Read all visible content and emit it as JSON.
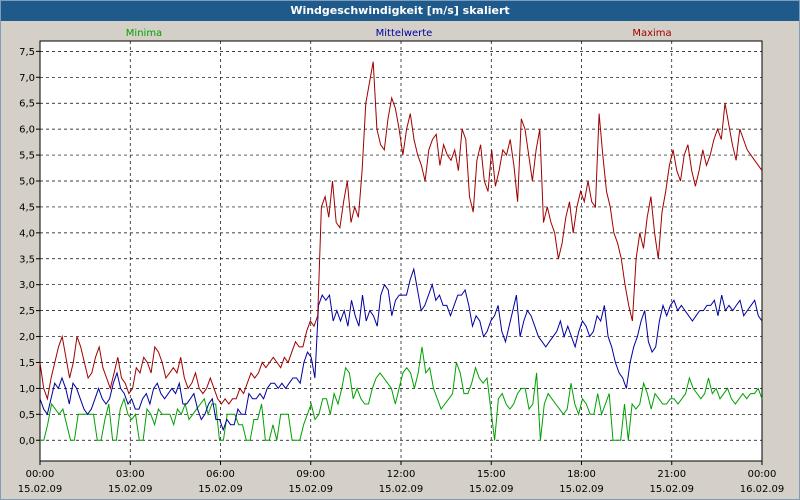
{
  "window": {
    "title": "Windgeschwindigkeit [m/s] skaliert"
  },
  "chart_data": {
    "type": "line",
    "title": "Windgeschwindigkeit [m/s] skaliert",
    "xlabel": "",
    "ylabel": "",
    "ylim": [
      -0.4,
      7.7
    ],
    "xlim": [
      0,
      24
    ],
    "yticks": [
      "0,0",
      "0,5",
      "1,0",
      "1,5",
      "2,0",
      "2,5",
      "3,0",
      "3,5",
      "4,0",
      "4,5",
      "5,0",
      "5,5",
      "6,0",
      "6,5",
      "7,0",
      "7,5"
    ],
    "ytick_values": [
      0,
      0.5,
      1,
      1.5,
      2,
      2.5,
      3,
      3.5,
      4,
      4.5,
      5,
      5.5,
      6,
      6.5,
      7,
      7.5
    ],
    "xticks": [
      {
        "x": 0,
        "time": "00:00",
        "date": "15.02.09"
      },
      {
        "x": 3,
        "time": "03:00",
        "date": "15.02.09"
      },
      {
        "x": 6,
        "time": "06:00",
        "date": "15.02.09"
      },
      {
        "x": 9,
        "time": "09:00",
        "date": "15.02.09"
      },
      {
        "x": 12,
        "time": "12:00",
        "date": "15.02.09"
      },
      {
        "x": 15,
        "time": "15:00",
        "date": "15.02.09"
      },
      {
        "x": 18,
        "time": "18:00",
        "date": "15.02.09"
      },
      {
        "x": 21,
        "time": "21:00",
        "date": "15.02.09"
      },
      {
        "x": 24,
        "time": "00:00",
        "date": "16.02.09"
      }
    ],
    "grid": true,
    "legend_position": "top",
    "series": [
      {
        "name": "Minima",
        "color": "#00a000",
        "values": [
          0.0,
          0.0,
          0.3,
          0.7,
          0.6,
          0.5,
          0.6,
          0.3,
          0.0,
          0.0,
          0.5,
          0.5,
          0.5,
          0.5,
          0.5,
          0.0,
          0.0,
          0.4,
          0.7,
          0.0,
          0.0,
          0.6,
          0.8,
          0.5,
          0.4,
          0.5,
          0.0,
          0.0,
          0.6,
          0.5,
          0.3,
          0.6,
          0.5,
          0.5,
          0.5,
          0.3,
          0.6,
          0.5,
          0.7,
          0.4,
          0.5,
          0.6,
          0.7,
          0.8,
          0.5,
          0.7,
          0.7,
          0.0,
          0.0,
          0.5,
          0.5,
          0.5,
          0.3,
          0.3,
          0.0,
          0.0,
          0.4,
          0.4,
          0.7,
          0.0,
          0.0,
          0.3,
          0.0,
          0.5,
          0.5,
          0.5,
          0.0,
          0.0,
          0.0,
          0.3,
          0.5,
          0.7,
          0.4,
          0.5,
          0.8,
          0.8,
          0.5,
          0.9,
          0.7,
          1.0,
          1.4,
          1.3,
          0.8,
          1.0,
          0.8,
          0.7,
          0.7,
          1.0,
          1.2,
          1.3,
          1.2,
          1.1,
          1.0,
          0.7,
          1.0,
          1.3,
          1.4,
          1.3,
          1.0,
          1.3,
          1.8,
          1.3,
          1.4,
          1.0,
          0.8,
          0.6,
          0.7,
          0.8,
          0.9,
          1.5,
          1.3,
          0.9,
          0.9,
          1.1,
          1.4,
          1.2,
          1.1,
          1.2,
          0.6,
          0.0,
          0.8,
          0.9,
          0.7,
          0.6,
          0.7,
          0.9,
          1.0,
          1.0,
          0.6,
          0.7,
          1.3,
          0.0,
          0.7,
          0.9,
          0.8,
          0.7,
          0.6,
          0.5,
          0.6,
          1.1,
          0.7,
          0.5,
          0.8,
          0.7,
          0.5,
          0.5,
          0.9,
          0.5,
          0.7,
          0.9,
          0.0,
          0.0,
          0.0,
          0.7,
          0.0,
          0.7,
          0.6,
          0.7,
          1.1,
          0.9,
          0.6,
          0.9,
          0.8,
          0.7,
          0.7,
          0.8,
          0.8,
          0.7,
          0.8,
          0.9,
          1.2,
          1.0,
          0.9,
          0.8,
          0.9,
          1.2,
          0.9,
          1.0,
          0.8,
          0.9,
          1.0,
          0.8,
          0.7,
          0.8,
          0.9,
          0.8,
          0.9,
          0.9,
          1.0,
          0.8
        ]
      },
      {
        "name": "Mittelwerte",
        "color": "#0000a0",
        "values": [
          0.8,
          0.6,
          0.5,
          0.8,
          1.1,
          1.0,
          1.2,
          1.0,
          0.7,
          1.1,
          1.0,
          0.8,
          0.6,
          0.5,
          0.6,
          0.8,
          1.0,
          0.8,
          0.7,
          0.8,
          1.1,
          1.3,
          1.0,
          0.9,
          0.7,
          0.8,
          0.6,
          0.6,
          0.8,
          0.9,
          0.7,
          1.0,
          1.1,
          0.9,
          0.8,
          0.9,
          1.0,
          0.9,
          1.1,
          0.7,
          0.7,
          0.8,
          0.9,
          0.6,
          0.4,
          0.5,
          0.7,
          0.8,
          0.4,
          0.4,
          0.2,
          0.4,
          0.3,
          0.3,
          0.6,
          0.5,
          0.5,
          0.9,
          0.8,
          0.8,
          0.9,
          0.8,
          1.0,
          1.1,
          1.1,
          1.0,
          1.1,
          1.0,
          1.1,
          1.2,
          1.2,
          1.1,
          1.5,
          1.7,
          1.6,
          1.2,
          2.6,
          2.8,
          2.7,
          2.8,
          2.3,
          2.5,
          2.3,
          2.5,
          2.2,
          2.7,
          2.4,
          2.2,
          2.8,
          2.3,
          2.5,
          2.4,
          2.2,
          2.8,
          3.0,
          2.9,
          2.4,
          2.7,
          2.8,
          2.8,
          2.8,
          3.1,
          3.3,
          2.9,
          2.5,
          2.6,
          2.8,
          3.0,
          2.7,
          2.8,
          2.6,
          2.6,
          2.4,
          2.6,
          2.8,
          2.8,
          2.9,
          2.6,
          2.2,
          2.4,
          2.3,
          2.0,
          2.1,
          2.3,
          2.4,
          2.6,
          2.1,
          1.9,
          2.2,
          2.5,
          2.8,
          2.0,
          2.3,
          2.5,
          2.4,
          2.2,
          2.0,
          1.9,
          1.8,
          1.9,
          2.0,
          2.1,
          2.3,
          2.0,
          2.2,
          2.0,
          1.8,
          2.1,
          2.3,
          2.2,
          2.0,
          2.1,
          2.4,
          2.3,
          2.6,
          2.0,
          1.8,
          1.5,
          1.3,
          1.2,
          1.0,
          1.5,
          1.8,
          2.0,
          2.3,
          2.5,
          1.9,
          1.7,
          1.8,
          2.3,
          2.6,
          2.4,
          2.6,
          2.7,
          2.5,
          2.6,
          2.5,
          2.4,
          2.3,
          2.4,
          2.5,
          2.5,
          2.6,
          2.6,
          2.7,
          2.4,
          2.8,
          2.5,
          2.6,
          2.5,
          2.6,
          2.7,
          2.4,
          2.5,
          2.6,
          2.7,
          2.4,
          2.3
        ]
      },
      {
        "name": "Maxima",
        "color": "#a00000",
        "values": [
          1.5,
          1.0,
          0.8,
          1.2,
          1.5,
          1.8,
          2.0,
          1.6,
          1.2,
          1.5,
          2.0,
          1.8,
          1.5,
          1.2,
          1.3,
          1.6,
          1.8,
          1.4,
          1.2,
          1.0,
          1.3,
          1.6,
          1.2,
          1.1,
          0.9,
          1.0,
          1.4,
          1.3,
          1.6,
          1.5,
          1.3,
          1.8,
          1.7,
          1.5,
          1.2,
          1.3,
          1.4,
          1.3,
          1.6,
          1.2,
          1.0,
          1.1,
          1.3,
          1.0,
          0.9,
          1.0,
          1.2,
          1.0,
          0.8,
          0.7,
          0.8,
          0.7,
          0.8,
          0.8,
          1.0,
          0.9,
          1.1,
          1.3,
          1.2,
          1.3,
          1.5,
          1.4,
          1.5,
          1.6,
          1.5,
          1.4,
          1.6,
          1.5,
          1.7,
          1.9,
          1.8,
          1.8,
          2.1,
          2.3,
          2.2,
          2.4,
          4.5,
          4.7,
          4.3,
          5.0,
          4.2,
          4.1,
          4.6,
          5.0,
          4.2,
          4.5,
          4.3,
          5.2,
          6.5,
          6.9,
          7.3,
          6.0,
          5.7,
          5.6,
          6.2,
          6.6,
          6.4,
          6.0,
          5.5,
          6.0,
          6.3,
          5.8,
          5.5,
          5.3,
          5.0,
          5.6,
          5.8,
          5.9,
          5.3,
          5.7,
          5.5,
          5.4,
          5.6,
          5.2,
          6.0,
          5.8,
          4.7,
          4.4,
          5.4,
          5.7,
          5.0,
          4.8,
          5.6,
          4.9,
          5.2,
          5.6,
          5.5,
          5.8,
          5.3,
          4.6,
          6.2,
          6.0,
          5.5,
          5.0,
          5.6,
          6.0,
          4.2,
          4.5,
          4.2,
          4.0,
          3.5,
          3.8,
          4.3,
          4.6,
          4.0,
          4.5,
          4.8,
          4.6,
          5.0,
          4.6,
          4.5,
          6.3,
          5.5,
          4.8,
          4.5,
          4.0,
          3.8,
          3.5,
          3.0,
          2.6,
          2.3,
          3.5,
          4.0,
          3.7,
          4.3,
          4.7,
          4.0,
          3.5,
          4.4,
          4.8,
          5.3,
          5.6,
          5.2,
          5.0,
          5.5,
          5.7,
          5.2,
          4.9,
          5.2,
          5.6,
          5.3,
          5.5,
          5.8,
          6.0,
          5.8,
          6.5,
          6.1,
          5.7,
          5.4,
          6.0,
          5.8,
          5.6,
          5.5,
          5.4,
          5.3,
          5.2
        ]
      }
    ]
  }
}
